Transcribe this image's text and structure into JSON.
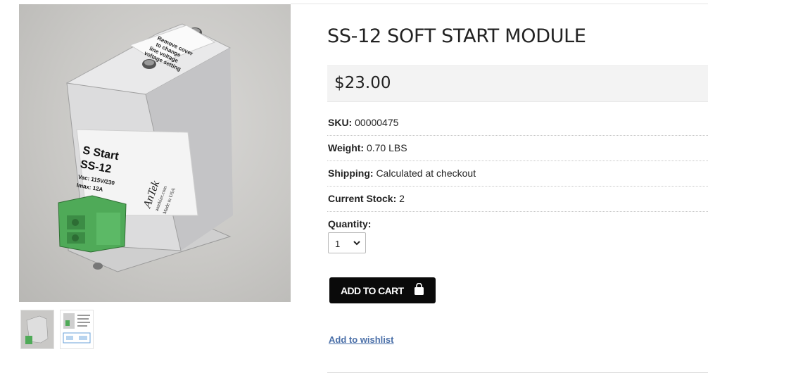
{
  "product": {
    "title": "SS-12 SOFT START MODULE",
    "price": "$23.00"
  },
  "image": {
    "sticker_top_lines": [
      "Remove cover",
      "to change",
      "line voltage",
      "voltage setting"
    ],
    "label_lines": [
      "S Start",
      "SS-12",
      "Vac: 115V/230",
      "Imax: 12A"
    ],
    "brand_lines": [
      "AnTek",
      "antekinc.com",
      "Made in USA"
    ]
  },
  "specs": [
    {
      "label": "SKU:",
      "value": "00000475"
    },
    {
      "label": "Weight:",
      "value": "0.70 LBS"
    },
    {
      "label": "Shipping:",
      "value": "Calculated at checkout"
    },
    {
      "label": "Current Stock:",
      "value": "2"
    }
  ],
  "quantity": {
    "label": "Quantity:",
    "selected": "1"
  },
  "actions": {
    "add_to_cart": "ADD TO CART",
    "wishlist": "Add to wishlist"
  },
  "icons": {
    "cart": "shopping-bag-icon",
    "select": "chevron-down-icon"
  }
}
